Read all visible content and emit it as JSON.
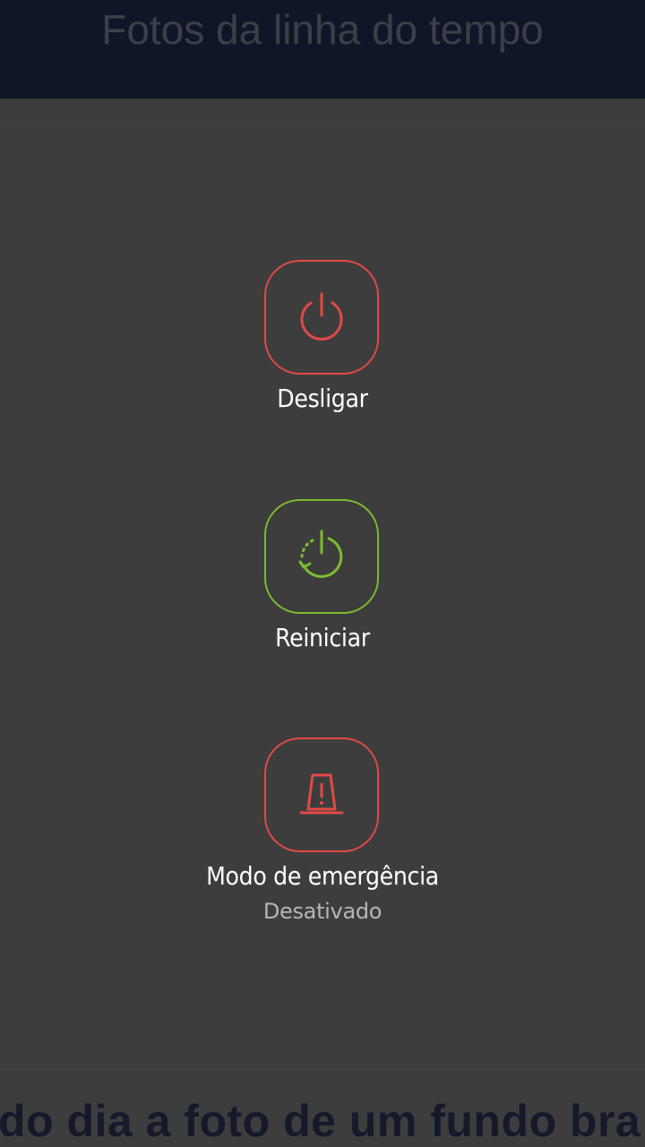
{
  "background_app": {
    "header_title": "Fotos da linha do tempo",
    "bottom_text": "do dia a foto de um fundo bra"
  },
  "power_menu": {
    "power_off": {
      "label": "Desligar",
      "icon": "power-icon",
      "color": "#e14a45"
    },
    "restart": {
      "label": "Reiniciar",
      "icon": "restart-icon",
      "color": "#7bbd2e"
    },
    "emergency": {
      "label": "Modo de emergência",
      "status": "Desativado",
      "icon": "emergency-siren-icon",
      "color": "#e14a45"
    }
  }
}
